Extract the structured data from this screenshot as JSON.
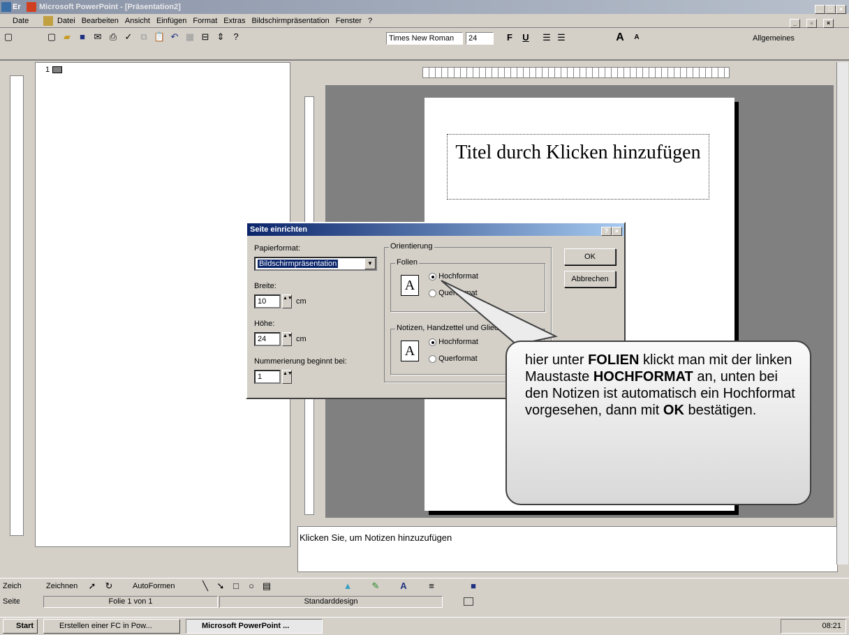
{
  "window": {
    "title": "Microsoft PowerPoint - [Präsentation2]",
    "outer_fragment_1": "Er",
    "outer_fragment_2": "Datei"
  },
  "menu": [
    "Datei",
    "Bearbeiten",
    "Ansicht",
    "Einfügen",
    "Format",
    "Extras",
    "Bildschirmpräsentation",
    "Fenster",
    "?"
  ],
  "toolbar": {
    "font": "Times New Roman",
    "size": "24",
    "bold": "F",
    "underline": "U",
    "design_label": "Allgemeines"
  },
  "outline": {
    "slide_number": "1"
  },
  "slide": {
    "title_placeholder": "Titel durch Klicken hinzufügen"
  },
  "notes": {
    "placeholder": "Klicken Sie, um Notizen hinzuzufügen"
  },
  "dialog": {
    "title": "Seite einrichten",
    "help": "?",
    "close": "×",
    "paper_label": "Papierformat:",
    "paper_value": "Bildschirmpräsentation",
    "width_label": "Breite:",
    "width_value": "10",
    "width_unit": "cm",
    "height_label": "Höhe:",
    "height_value": "24",
    "height_unit": "cm",
    "numbering_label": "Nummerierung beginnt bei:",
    "numbering_value": "1",
    "orientation_label": "Orientierung",
    "slides_label": "Folien",
    "portrait": "Hochformat",
    "landscape": "Querformat",
    "notes_group": "Notizen, Handzettel und Gliederung",
    "ok": "OK",
    "cancel": "Abbrechen"
  },
  "callout": {
    "p1": "hier unter ",
    "b1": "FOLIEN",
    "p2": " klickt man mit der linken Maustaste ",
    "b2": "HOCHFORMAT",
    "p3": " an, unten bei den Notizen ist automatisch ein Hochformat vorgesehen, dann mit ",
    "b3": "OK",
    "p4": " bestätigen."
  },
  "drawing": {
    "label": "Zeichnen",
    "autoshapes": "AutoFormen",
    "fragment": "Zeich"
  },
  "status": {
    "slide": "Folie 1 von 1",
    "design": "Standarddesign",
    "fragment": "Seite"
  },
  "taskbar": {
    "start": "Start",
    "task1": "Erstellen einer FC in Pow...",
    "task2": "Microsoft PowerPoint ...",
    "time": "08:21"
  }
}
